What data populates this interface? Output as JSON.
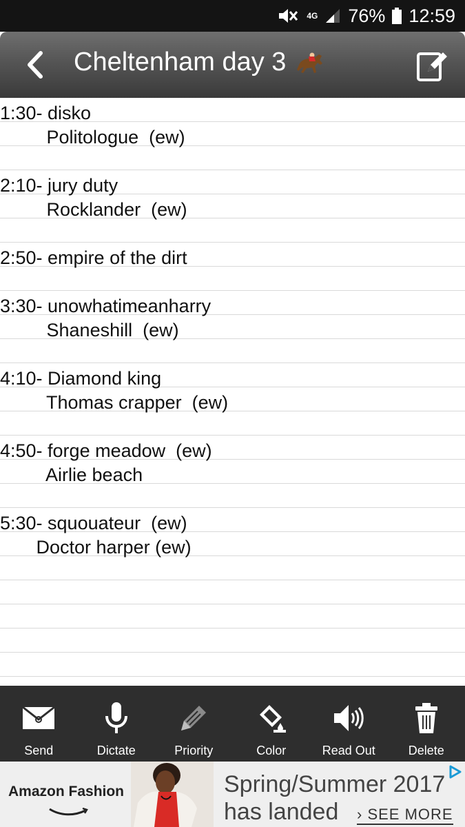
{
  "status_bar": {
    "battery": "76%",
    "time": "12:59",
    "network": "4G"
  },
  "header": {
    "title": "Cheltenham day 3"
  },
  "note_lines": [
    "1:30- disko",
    "         Politologue  (ew)",
    "",
    "2:10- jury duty",
    "         Rocklander  (ew)",
    "",
    "2:50- empire of the dirt",
    "",
    "3:30- unowhatimeanharry",
    "         Shaneshill  (ew)",
    "",
    "4:10- Diamond king",
    "         Thomas crapper  (ew)",
    "",
    "4:50- forge meadow  (ew)",
    "         Airlie beach",
    "",
    "5:30- squouateur  (ew)",
    "       Doctor harper (ew)"
  ],
  "toolbar": [
    {
      "label": "Send",
      "icon": "envelope-icon"
    },
    {
      "label": "Dictate",
      "icon": "microphone-icon"
    },
    {
      "label": "Priority",
      "icon": "pencil-icon"
    },
    {
      "label": "Color",
      "icon": "paint-bucket-icon"
    },
    {
      "label": "Read Out",
      "icon": "speaker-icon"
    },
    {
      "label": "Delete",
      "icon": "trash-icon"
    }
  ],
  "ad": {
    "brand": "Amazon Fashion",
    "headline_1": "Spring/Summer 2017",
    "headline_2": "has landed",
    "cta": "› SEE MORE"
  }
}
